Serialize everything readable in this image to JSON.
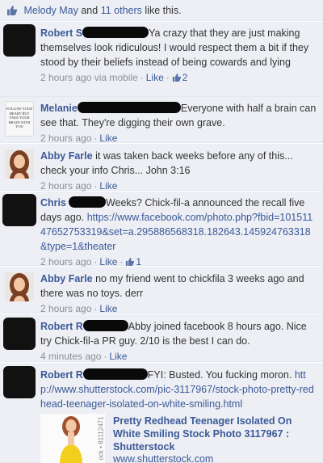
{
  "likes_bar": {
    "name1": "Melody May",
    "and": "and",
    "others": "11 others",
    "suffix": "like this."
  },
  "comments": [
    {
      "name": "Robert S",
      "text": "Ya crazy that they are just making themselves look ridiculous! I would respect them a bit if they stood by their beliefs instead of being cowards and lying",
      "time": "2 hours ago via mobile",
      "like": "Like",
      "like_count": "2"
    },
    {
      "avatar_text": "FOLLOW YOUR HEART BUT TAKE YOUR BRAIN WITH YOU",
      "name": "Melanie",
      "text": "Everyone with half a brain can see that. They're digging their own grave.",
      "time": "2 hours ago",
      "like": "Like"
    },
    {
      "name": "Abby Farle",
      "text": "it was taken back weeks before any of this... check your info Chris... John 3:16",
      "time": "2 hours ago",
      "like": "Like"
    },
    {
      "name": "Chris",
      "text": "Weeks? Chick-fil-a announced the recall five days ago.",
      "url": "https://www.facebook.com/photo.php?fbid=10151147652753319&set=a.295886568318.182643.145924763318&type=1&theater",
      "time": "2 hours ago",
      "like": "Like",
      "like_count": "1"
    },
    {
      "name": "Abby Farle",
      "text": "no my friend went to chickfila 3 weeks ago and there was no toys. derr",
      "time": "2 hours ago",
      "like": "Like"
    },
    {
      "name": "Robert R",
      "text": "Abby joined facebook 8 hours ago. Nice try Chick-fil-a PR guy. 2/10 is the best I can do.",
      "time": "4 minutes ago",
      "like": "Like"
    },
    {
      "name": "Robert R",
      "text": "FYI: Busted. You fucking moron.",
      "url": "http://www.shutterstock.com/pic-3117967/stock-photo-pretty-redhead-teenager-isolated-on-white-smiling.html"
    }
  ],
  "link_preview": {
    "title": "Pretty Redhead Teenager Isolated On White Smiling Stock Photo 3117967 : Shutterstock",
    "source": "www.shutterstock.com",
    "watermark": "ock • 81112471"
  },
  "colors": {
    "link": "#3b5998",
    "background": "#edeff4",
    "meta": "#8a8f99"
  }
}
